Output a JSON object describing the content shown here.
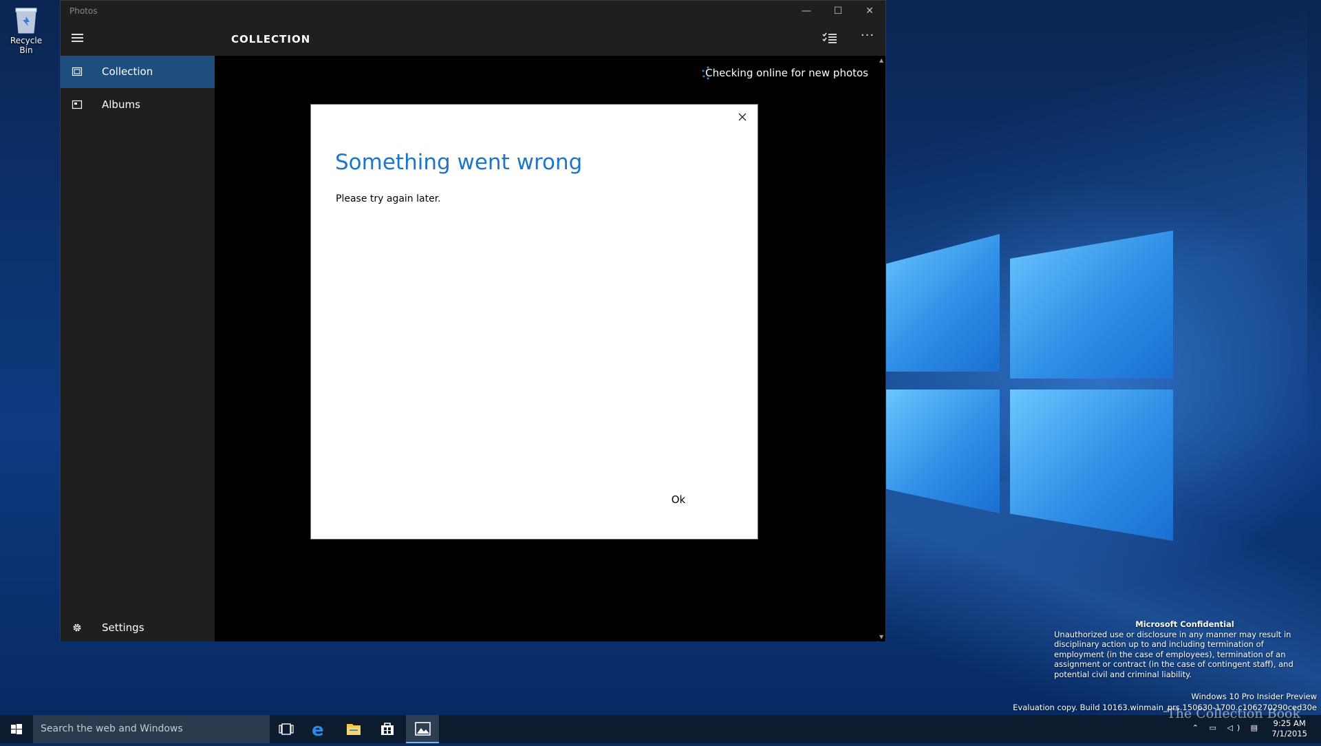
{
  "desktop": {
    "recycle_bin_label": "Recycle Bin",
    "watermark": {
      "title": "Microsoft Confidential",
      "body": "Unauthorized use or disclosure in any manner may result in disciplinary action up to and including termination of employment (in the case of employees), termination of an assignment or contract (in the case of contingent staff), and potential civil and criminal liability."
    },
    "build": {
      "edition": "Windows 10 Pro Insider Preview",
      "evaluation": "Evaluation copy. Build 10163.winmain_prs.150630-1700.c106270290ced30e"
    },
    "site_watermark": "The Collection Book"
  },
  "window": {
    "title": "Photos",
    "controls": {
      "minimize": "—",
      "maximize": "☐",
      "close": "✕"
    },
    "appbar": {
      "page_title": "COLLECTION",
      "more_label": "···"
    },
    "nav": {
      "items": [
        {
          "label": "Collection",
          "icon": "collection-icon",
          "selected": true
        },
        {
          "label": "Albums",
          "icon": "albums-icon",
          "selected": false
        }
      ],
      "settings_label": "Settings"
    },
    "status_text": "Checking online for new photos"
  },
  "dialog": {
    "title": "Something went wrong",
    "message": "Please try again later.",
    "ok_label": "Ok"
  },
  "taskbar": {
    "search_placeholder": "Search the web and Windows",
    "pinned": [
      "task-view-icon",
      "edge-icon",
      "file-explorer-icon",
      "store-icon",
      "photos-icon"
    ],
    "active_app": "Photos",
    "clock": {
      "time": "9:25 AM",
      "date": "7/1/2015"
    }
  },
  "colors": {
    "accent": "#1e4e7d",
    "dialog_title": "#1c75c9",
    "nav_background": "#1f1f1f",
    "taskbar": "#0d1b2e"
  }
}
